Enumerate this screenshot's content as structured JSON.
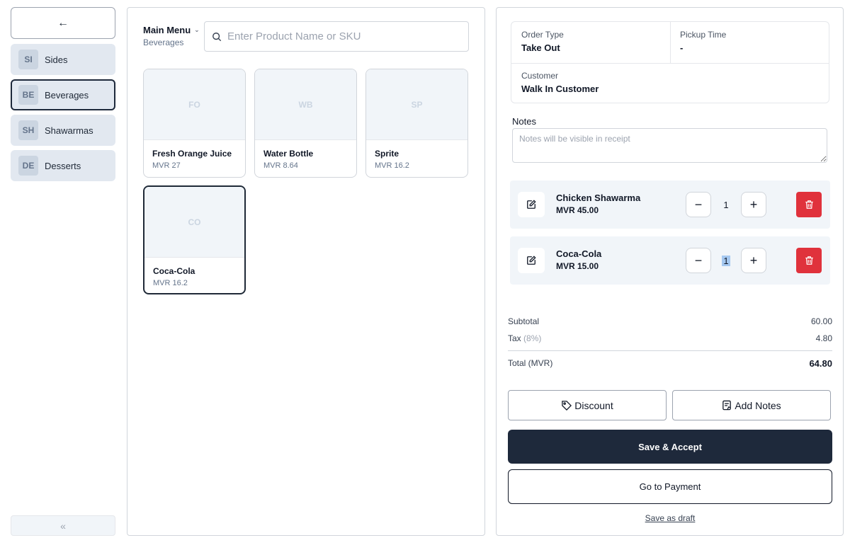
{
  "sidebar": {
    "back_label": "←",
    "categories": [
      {
        "abbr": "SI",
        "label": "Sides"
      },
      {
        "abbr": "BE",
        "label": "Beverages"
      },
      {
        "abbr": "SH",
        "label": "Shawarmas"
      },
      {
        "abbr": "DE",
        "label": "Desserts"
      }
    ],
    "active_category": "Beverages",
    "collapse_label": "«"
  },
  "menu": {
    "title": "Main Menu",
    "chevron": "⌄",
    "subtitle": "Beverages"
  },
  "search": {
    "placeholder": "Enter Product Name or SKU",
    "value": ""
  },
  "products": [
    {
      "abbr": "FO",
      "name": "Fresh Orange Juice",
      "price": "MVR 27"
    },
    {
      "abbr": "WB",
      "name": "Water Bottle",
      "price": "MVR 8.64"
    },
    {
      "abbr": "SP",
      "name": "Sprite",
      "price": "MVR 16.2"
    },
    {
      "abbr": "CO",
      "name": "Coca-Cola",
      "price": "MVR 16.2"
    }
  ],
  "order": {
    "order_type_label": "Order Type",
    "order_type_value": "Take Out",
    "pickup_label": "Pickup Time",
    "pickup_value": "-",
    "customer_label": "Customer",
    "customer_value": "Walk In Customer",
    "notes_label": "Notes",
    "notes_placeholder": "Notes will be visible in receipt",
    "items": [
      {
        "name": "Chicken Shawarma",
        "price": "MVR 45.00",
        "qty": "1"
      },
      {
        "name": "Coca-Cola",
        "price": "MVR 15.00",
        "qty": "1"
      }
    ]
  },
  "totals": {
    "subtotal_label": "Subtotal",
    "subtotal_value": "60.00",
    "tax_label": "Tax",
    "tax_pct": "(8%)",
    "tax_value": "4.80",
    "total_label": "Total (MVR)",
    "total_value": "64.80"
  },
  "actions": {
    "discount": "Discount",
    "add_notes": "Add Notes",
    "save_accept": "Save & Accept",
    "go_to_payment": "Go to Payment",
    "save_draft": "Save as draft"
  },
  "colors": {
    "primary_dark": "#1e293b",
    "danger": "#e0323c",
    "category_bg": "#e2e8f0",
    "item_bg": "#f1f5f9"
  }
}
